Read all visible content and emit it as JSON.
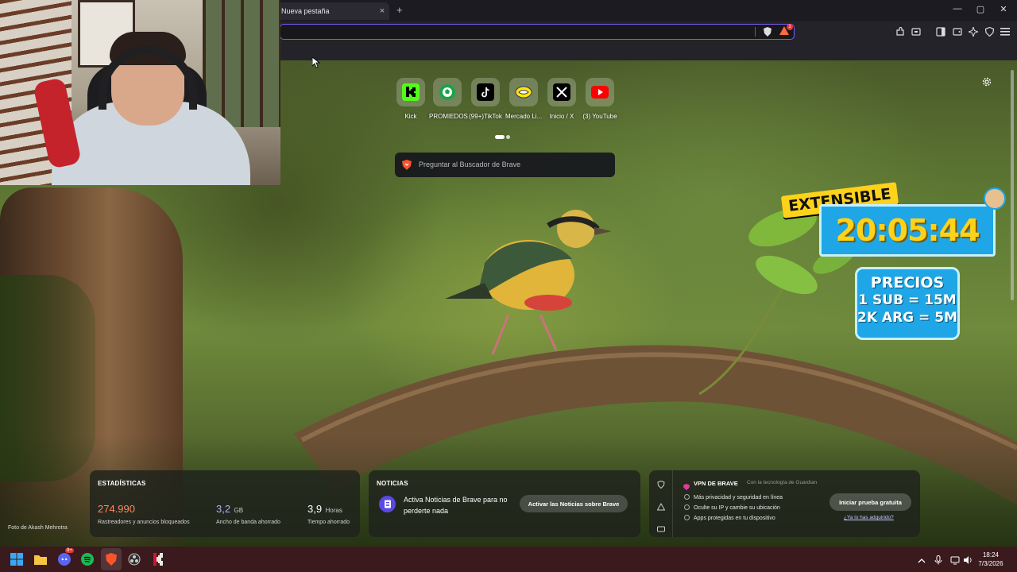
{
  "tab": {
    "title": "Nueva pestaña",
    "close": "×",
    "new_tab": "+"
  },
  "window_controls": {
    "minimize": "—",
    "maximize": "▢",
    "close": "✕"
  },
  "address_bar": {
    "value": "",
    "placeholder": "",
    "rewards_badge": "1"
  },
  "toolbar_icons": [
    "extensions-icon",
    "tab-search-icon",
    "sidebar-icon",
    "wallet-icon",
    "leo-ai-icon",
    "vpn-icon",
    "menu-icon"
  ],
  "quick_links": [
    {
      "label": "Kick",
      "icon": "kick-icon",
      "color": "#53fc18"
    },
    {
      "label": "PROMIEDOS",
      "icon": "soccer-ball-icon",
      "color": "#1ca34a"
    },
    {
      "label": "(99+)TikTok",
      "icon": "tiktok-icon",
      "color": "#000000"
    },
    {
      "label": "Mercado Li...",
      "icon": "mercadolibre-icon",
      "color": "#ffe600"
    },
    {
      "label": "Inicio / X",
      "icon": "x-icon",
      "color": "#000000"
    },
    {
      "label": "(3) YouTube",
      "icon": "youtube-icon",
      "color": "#ff0000"
    }
  ],
  "search": {
    "placeholder": "Preguntar al Buscador de Brave"
  },
  "overlay": {
    "extensible_label": "EXTENSIBLE",
    "timer": "20:05:44",
    "prices_title": "PRECIOS",
    "prices_line1": "1 SUB = 15M",
    "prices_line2": "2K ARG = 5M"
  },
  "stats": {
    "title": "ESTADÍSTICAS",
    "trackers_value": "274.990",
    "trackers_label": "Rastreadores y anuncios bloqueados",
    "bandwidth_value": "3,2",
    "bandwidth_unit": "GB",
    "bandwidth_label": "Ancho de banda ahorrado",
    "time_value": "3,9",
    "time_unit": "Horas",
    "time_label": "Tiempo ahorrado",
    "colors": {
      "trackers": "#ff8a5c",
      "bandwidth": "#b7a8ff",
      "time": "#ffffff"
    }
  },
  "news": {
    "title": "NOTICIAS",
    "text": "Activa Noticias de Brave para no perderte nada",
    "button": "Activar las Noticias sobre Brave"
  },
  "vpn": {
    "title": "VPN DE BRAVE",
    "subtitle": "Con la tecnología de Guardian",
    "features": [
      "Más privacidad y seguridad en línea",
      "Oculte su IP y cambie su ubicación",
      "Apps protegidas en tu dispositivo"
    ],
    "button": "Iniciar prueba gratuita",
    "link": "¿Ya lo has adquirido?"
  },
  "photo_credit": "Foto de Akash Mehrotra",
  "taskbar": {
    "apps": [
      "windows-start-icon",
      "file-explorer-icon",
      "discord-icon",
      "spotify-icon",
      "brave-icon",
      "obs-icon",
      "kick-app-icon"
    ],
    "discord_badge": "9+",
    "time": "18:24",
    "date": "7/3/2026"
  }
}
